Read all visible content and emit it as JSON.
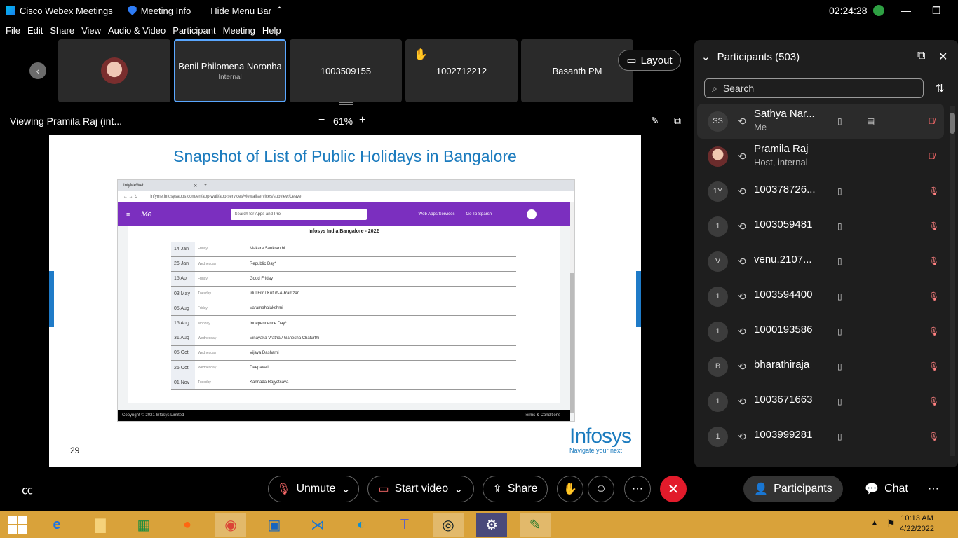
{
  "titlebar": {
    "app_name": "Cisco Webex Meetings",
    "meeting_info": "Meeting Info",
    "hide_menu": "Hide Menu Bar",
    "time": "02:24:28"
  },
  "menu": [
    "File",
    "Edit",
    "Share",
    "View",
    "Audio & Video",
    "Participant",
    "Meeting",
    "Help"
  ],
  "video_tiles": [
    {
      "name": "",
      "sub": ""
    },
    {
      "name": "Benil Philomena Noronha",
      "sub": "Internal"
    },
    {
      "name": "1003509155",
      "sub": ""
    },
    {
      "name": "1002712212",
      "sub": ""
    },
    {
      "name": "Basanth PM",
      "sub": ""
    }
  ],
  "layout_label": "Layout",
  "viewing": {
    "text": "Viewing Pramila Raj (int...",
    "zoom": "61%",
    "minus": "−",
    "plus": "+"
  },
  "slide": {
    "title": "Snapshot of List of Public Holidays in Bangalore",
    "page_number": "29",
    "browser_tab": "InfyMeWeb",
    "url": "infyme.infosysapps.com/en/app-wall/app-services/viewallservices/subview/Leave",
    "search_placeholder": "Search for Apps and Pro",
    "nav1": "Web Apps/Services",
    "nav2": "Go To Sparsh",
    "brand": "Me",
    "table_title": "Infosys India Bangalore - 2022",
    "holidays": [
      {
        "date": "14 Jan",
        "day": "Friday",
        "name": "Makara Sankranthi"
      },
      {
        "date": "26 Jan",
        "day": "Wednesday",
        "name": "Republic Day*"
      },
      {
        "date": "15 Apr",
        "day": "Friday",
        "name": "Good Friday"
      },
      {
        "date": "03 May",
        "day": "Tuesday",
        "name": "Idul Fitr / Kutub-A-Ramzan"
      },
      {
        "date": "05 Aug",
        "day": "Friday",
        "name": "Varamahalakshmi"
      },
      {
        "date": "15 Aug",
        "day": "Monday",
        "name": "Independence Day*"
      },
      {
        "date": "31 Aug",
        "day": "Wednesday",
        "name": "Vinayaka Vratha / Ganesha Chaturthi"
      },
      {
        "date": "05 Oct",
        "day": "Wednesday",
        "name": "Vijaya Dashami"
      },
      {
        "date": "26 Oct",
        "day": "Wednesday",
        "name": "Deepavali"
      },
      {
        "date": "01 Nov",
        "day": "Tuesday",
        "name": "Kannada Rajyotsava"
      }
    ],
    "copyright": "Copyright © 2021 Infosys Limited",
    "terms": "Terms & Conditions",
    "logo": "Infosys",
    "tagline": "Navigate your next"
  },
  "participants": {
    "title": "Participants (503)",
    "search_placeholder": "Search",
    "list": [
      {
        "initials": "SS",
        "name": "Sathya Nar...",
        "sub": "Me"
      },
      {
        "initials": "",
        "name": "Pramila Raj",
        "sub": "Host, internal"
      },
      {
        "initials": "1Y",
        "name": "100378726...",
        "sub": ""
      },
      {
        "initials": "1",
        "name": "1003059481",
        "sub": ""
      },
      {
        "initials": "V",
        "name": "venu.2107...",
        "sub": ""
      },
      {
        "initials": "1",
        "name": "1003594400",
        "sub": ""
      },
      {
        "initials": "1",
        "name": "1000193586",
        "sub": ""
      },
      {
        "initials": "B",
        "name": "bharathiraja",
        "sub": ""
      },
      {
        "initials": "1",
        "name": "1003671663",
        "sub": ""
      },
      {
        "initials": "1",
        "name": "1003999281",
        "sub": ""
      }
    ]
  },
  "toolbar": {
    "unmute": "Unmute",
    "start_video": "Start video",
    "share": "Share",
    "more": "···",
    "participants": "Participants",
    "chat": "Chat"
  },
  "taskbar": {
    "time": "10:13 AM",
    "date": "4/22/2022"
  }
}
